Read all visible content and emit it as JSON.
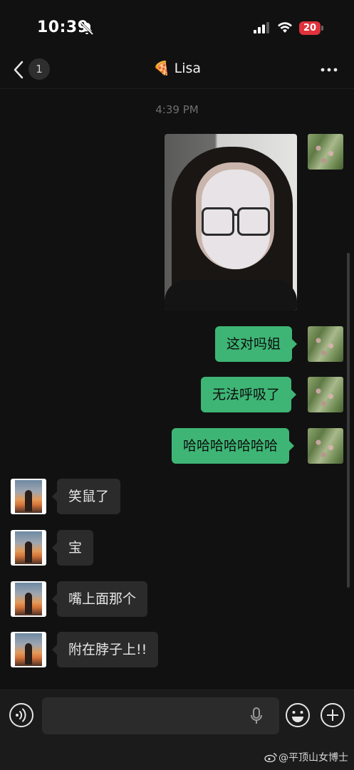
{
  "status_bar": {
    "time": "10:39",
    "battery": "20"
  },
  "nav": {
    "unread_count": "1",
    "title_emoji": "🍕",
    "title": "Lisa"
  },
  "timestamp": "4:39 PM",
  "messages": [
    {
      "direction": "out",
      "type": "image",
      "alt": ""
    },
    {
      "direction": "out",
      "type": "text",
      "text": "这对吗姐"
    },
    {
      "direction": "out",
      "type": "text",
      "text": "无法呼吸了"
    },
    {
      "direction": "out",
      "type": "text",
      "text": "哈哈哈哈哈哈哈"
    },
    {
      "direction": "in",
      "type": "text",
      "text": "笑鼠了"
    },
    {
      "direction": "in",
      "type": "text",
      "text": "宝"
    },
    {
      "direction": "in",
      "type": "text",
      "text": "嘴上面那个"
    },
    {
      "direction": "in",
      "type": "text",
      "text": "附在脖子上!!"
    }
  ],
  "input": {
    "placeholder": ""
  },
  "watermark": "@平顶山女博士",
  "colors": {
    "background": "#111111",
    "outgoing_bubble": "#3eb575",
    "incoming_bubble": "#2b2b2b",
    "battery": "#e0323c"
  }
}
